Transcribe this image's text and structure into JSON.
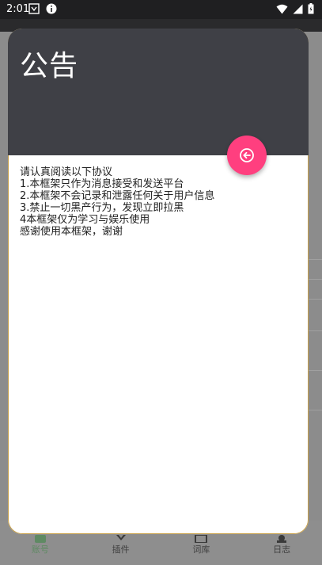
{
  "status_bar": {
    "time": "2:01",
    "icons": [
      "notification-icon",
      "info-icon",
      "wifi-icon",
      "signal-icon",
      "battery-icon"
    ]
  },
  "dialog": {
    "title": "公告",
    "lines": [
      "请认真阅读以下协议",
      "1.本框架只作为消息接受和发送平台",
      "2.本框架不会记录和泄露任何关于用户信息",
      "3.禁止一切黑产行为，发现立即拉黑",
      "4本框架仅为学习与娱乐使用",
      "感谢使用本框架，谢谢"
    ],
    "fab_icon": "back-arrow-icon"
  },
  "bottom_nav": {
    "items": [
      {
        "label": "账号",
        "icon": "account-icon",
        "active": true
      },
      {
        "label": "插件",
        "icon": "plugin-icon",
        "active": false
      },
      {
        "label": "词库",
        "icon": "library-icon",
        "active": false
      },
      {
        "label": "日志",
        "icon": "log-icon",
        "active": false
      }
    ]
  },
  "colors": {
    "header": "#3f4046",
    "fab": "#ff3f7f",
    "status_bar": "#1f1f21"
  }
}
